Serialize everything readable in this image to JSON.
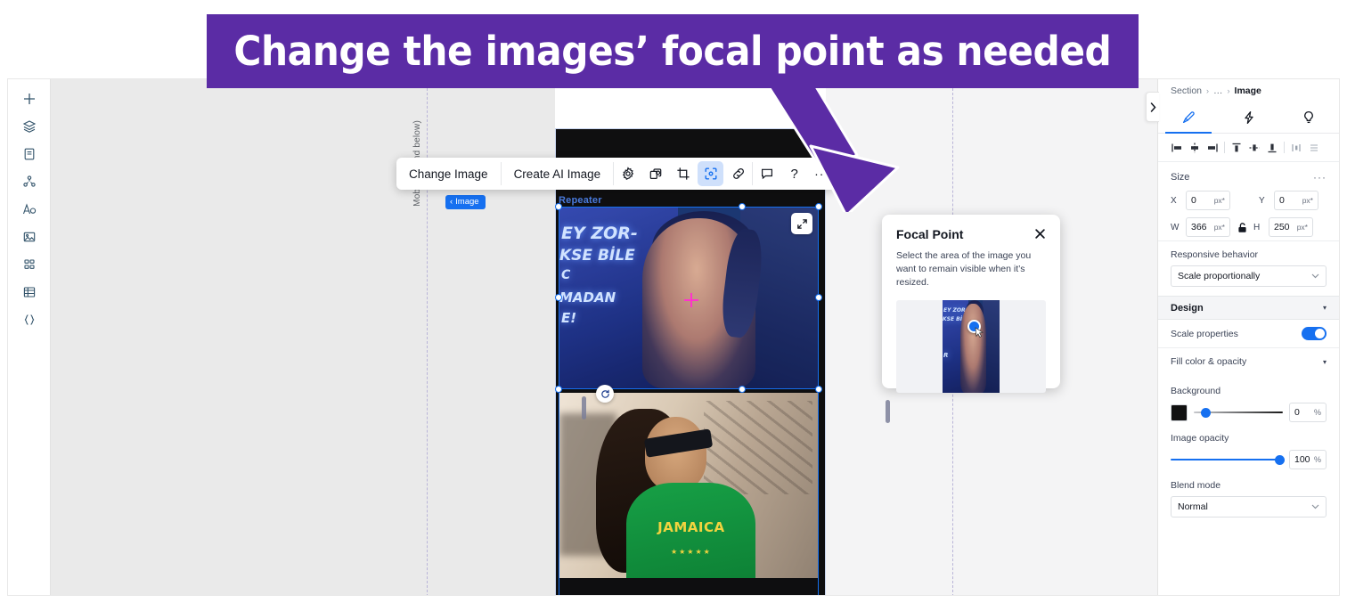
{
  "banner": {
    "text": "Change the images’ focal point as needed",
    "bg": "#5b2ca5",
    "text_color": "#ffffff"
  },
  "left_rail": {
    "items": [
      {
        "name": "add-icon",
        "glyph": "+"
      },
      {
        "name": "layers-icon",
        "glyph": "layers"
      },
      {
        "name": "page-icon",
        "glyph": "page"
      },
      {
        "name": "site-structure-icon",
        "glyph": "structure"
      },
      {
        "name": "text-icon",
        "glyph": "text"
      },
      {
        "name": "media-icon",
        "glyph": "media"
      },
      {
        "name": "apps-icon",
        "glyph": "apps"
      },
      {
        "name": "cms-icon",
        "glyph": "table"
      },
      {
        "name": "dev-mode-icon",
        "glyph": "{ }"
      }
    ]
  },
  "canvas": {
    "breakpoint_label": "Mobile ? (and below)",
    "repeater_label": "Repeater",
    "image_chip_label": "Image",
    "image_chip_prefix": "‹",
    "image1": {
      "alt": "Woman in front of blue graffiti wall",
      "graffiti_lines": [
        "EY ZOR-",
        "KSE BİLE",
        "C",
        "MADAN",
        "E!"
      ]
    },
    "image2": {
      "alt": "Woman with sunglasses wearing a green Jamaica t-shirt",
      "shirt_text": "JAMAICA",
      "shirt_stars": "★★★★★"
    }
  },
  "element_toolbar": {
    "change_image": "Change Image",
    "create_ai_image": "Create AI Image",
    "icons": [
      {
        "name": "settings-gear-icon",
        "active": false
      },
      {
        "name": "duplicate-layers-icon",
        "active": false
      },
      {
        "name": "crop-icon",
        "active": false
      },
      {
        "name": "focal-point-icon",
        "active": true
      },
      {
        "name": "link-icon",
        "active": false
      },
      {
        "name": "comment-icon",
        "active": false
      },
      {
        "name": "help-icon",
        "active": false
      },
      {
        "name": "more-options-icon",
        "active": false
      }
    ],
    "help_glyph": "?",
    "more_glyph": "···"
  },
  "focal_point_popup": {
    "title": "Focal Point",
    "description": "Select the area of the image you want to remain visible when it’s resized.",
    "close_label": "×"
  },
  "right_panel": {
    "breadcrumb": {
      "root": "Section",
      "ellipsis": "…",
      "current": "Image",
      "separator": "›"
    },
    "tabs": [
      {
        "name": "tab-design-brush",
        "active": true
      },
      {
        "name": "tab-interactions-bolt",
        "active": false
      },
      {
        "name": "tab-ideas-bulb",
        "active": false
      }
    ],
    "align_buttons": [
      "align-left-icon",
      "align-center-horizontal-icon",
      "align-right-icon",
      "align-top-icon",
      "align-middle-vertical-icon",
      "align-bottom-icon",
      "distribute-horizontal-icon",
      "distribute-vertical-icon"
    ],
    "size": {
      "title": "Size",
      "more_glyph": "···",
      "x_label": "X",
      "x_value": "0",
      "x_unit": "px*",
      "y_label": "Y",
      "y_value": "0",
      "y_unit": "px*",
      "w_label": "W",
      "w_value": "366",
      "w_unit": "px*",
      "h_label": "H",
      "h_value": "250",
      "h_unit": "px*",
      "lock_name": "aspect-ratio-lock-icon"
    },
    "responsive": {
      "label": "Responsive behavior",
      "value": "Scale proportionally"
    },
    "design_section": {
      "title": "Design",
      "caret": "▾"
    },
    "scale_properties": {
      "label": "Scale properties",
      "enabled": true
    },
    "fill_section": {
      "label": "Fill color & opacity",
      "caret": "▾"
    },
    "background": {
      "label": "Background",
      "color": "#111111",
      "value": "0",
      "unit": "%",
      "knob_pct": 12
    },
    "image_opacity": {
      "label": "Image opacity",
      "value": "100",
      "unit": "%",
      "knob_pct": 100
    },
    "blend_mode": {
      "label": "Blend mode",
      "value": "Normal"
    },
    "collapse_glyph": "›",
    "accent_color": "#1670f0"
  }
}
